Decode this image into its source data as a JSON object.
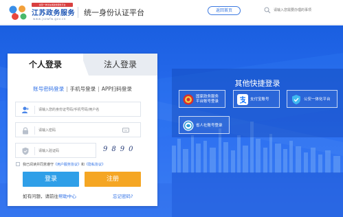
{
  "header": {
    "logo_ribbon": "全国一体化在线政务服务平台",
    "logo_title": "江苏政务服务",
    "logo_sub": "www.jszwfw.gov.cn",
    "platform_title": "统一身份认证平台",
    "home_button": "返回首页",
    "search_placeholder": "请输入您需要办理的事项"
  },
  "login": {
    "tab_person": "个人登录",
    "tab_legal": "法人登录",
    "methods": [
      "账号密码登录",
      "手机号登录",
      "APP扫码登录"
    ],
    "username_placeholder": "请输入您的身份证号码/手机号码/用户名",
    "password_placeholder": "请输入密码",
    "code_placeholder": "请输入验证码",
    "captcha": "9890",
    "agree_prefix": "我已阅读并同意遵守",
    "agree_link1": "《用户服务协议》",
    "agree_and": "和",
    "agree_link2": "《隐私协议》",
    "login_button": "登录",
    "register_button": "注册",
    "help_text": "如有问题，请前往",
    "help_link": "帮助中心",
    "forgot": "忘记密码?"
  },
  "quick": {
    "title": "其他快捷登录",
    "items": [
      {
        "label1": "国家政务服务",
        "label2": "平台账号登录"
      },
      {
        "label1": "支付宝账号",
        "label2": ""
      },
      {
        "label1": "公安一体化平台",
        "label2": ""
      },
      {
        "label1": "省人社账号登录",
        "label2": ""
      }
    ]
  },
  "colors": {
    "primary": "#2d6fe6",
    "login_button": "#2f9fe8",
    "register_button": "#f5a623",
    "hero": "#2a6df0"
  }
}
